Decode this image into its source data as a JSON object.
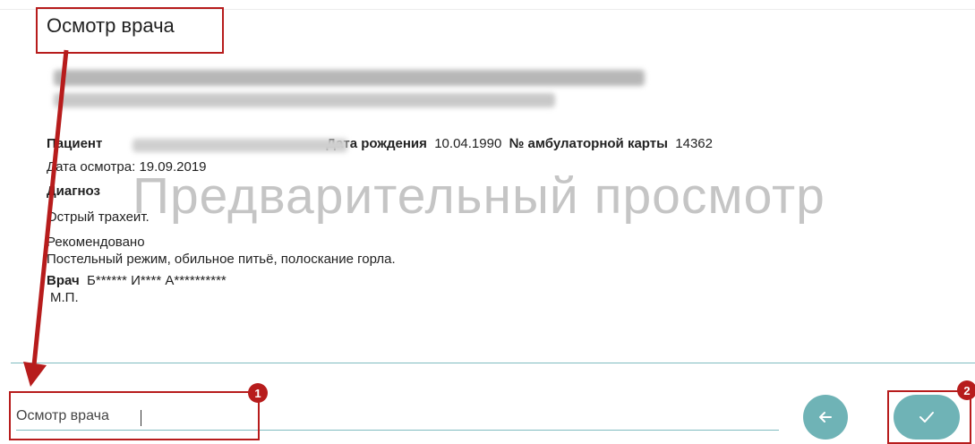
{
  "document": {
    "title": "Осмотр врача",
    "watermark": "Предварительный просмотр",
    "patient_label": "Пациент",
    "dob_label": "Дата рождения",
    "dob_value": "10.04.1990",
    "card_label": "№ амбулаторной карты",
    "card_value": "14362",
    "exam_date": "Дата осмотра: 19.09.2019",
    "diagnosis_label": "Диагноз",
    "diagnosis_value": "Острый трахеит.",
    "recommend_label": "Рекомендовано",
    "recommend_value": "Постельный режим, обильное питьё, полоскание горла.",
    "doctor_label": "Врач",
    "doctor_value": "Б****** И**** А**********",
    "stamp": "М.П."
  },
  "form": {
    "template_name_value": "Осмотр врача"
  },
  "annotations": {
    "badge1": "1",
    "badge2": "2"
  },
  "icons": {
    "back": "arrow-left-icon",
    "confirm": "check-icon"
  },
  "colors": {
    "accent": "#6fb3b6",
    "annotation": "#b71c1c",
    "watermark": "#c5c5c5"
  }
}
